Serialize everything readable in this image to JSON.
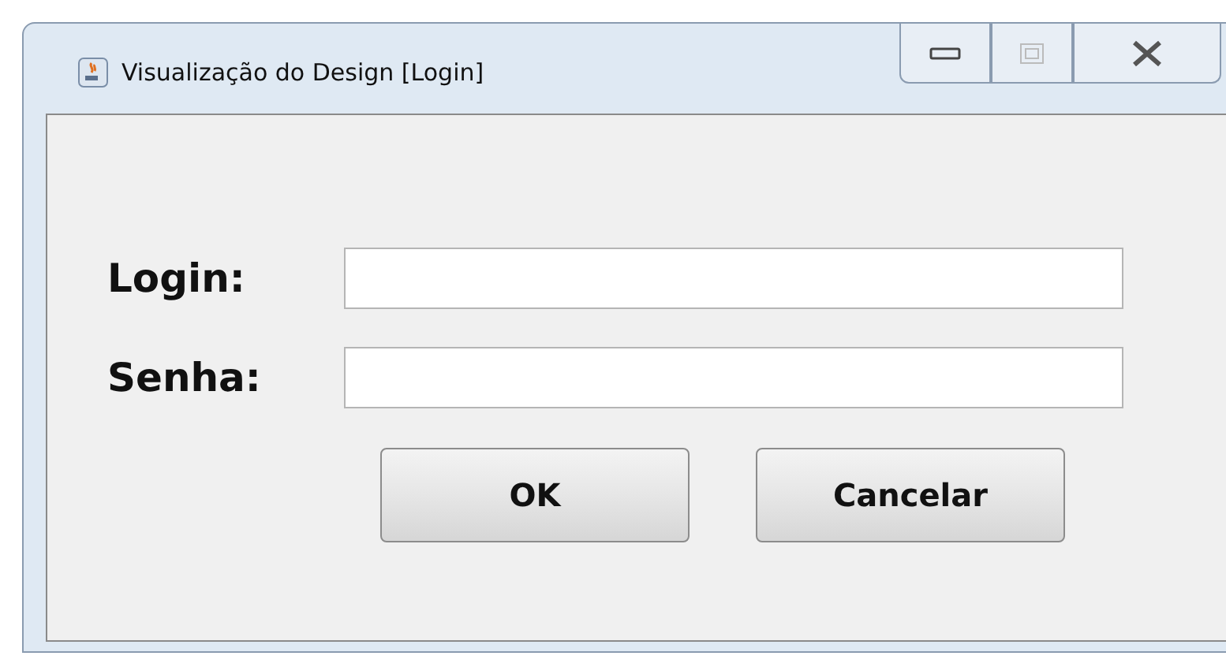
{
  "window": {
    "title": "Visualização do Design [Login]"
  },
  "fields": [
    {
      "label": "Login:"
    },
    {
      "label": "Senha:"
    }
  ],
  "buttons": [
    "OK",
    "Cancelar"
  ]
}
